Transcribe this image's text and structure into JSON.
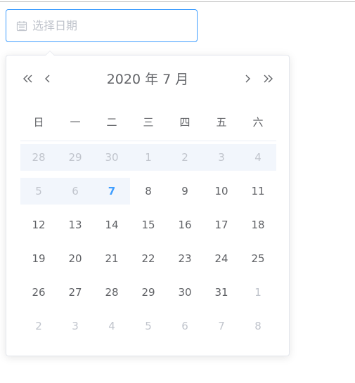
{
  "input": {
    "placeholder": "选择日期",
    "value": ""
  },
  "header": {
    "title": "2020 年  7 月"
  },
  "weekdays": [
    "日",
    "一",
    "二",
    "三",
    "四",
    "五",
    "六"
  ],
  "grid": [
    [
      {
        "d": "28",
        "o": true,
        "r": true
      },
      {
        "d": "29",
        "o": true,
        "r": true
      },
      {
        "d": "30",
        "o": true,
        "r": true
      },
      {
        "d": "1",
        "o": true,
        "r": true
      },
      {
        "d": "2",
        "o": true,
        "r": true
      },
      {
        "d": "3",
        "o": true,
        "r": true
      },
      {
        "d": "4",
        "o": true,
        "r": true
      }
    ],
    [
      {
        "d": "5",
        "o": true,
        "r": true
      },
      {
        "d": "6",
        "o": true,
        "r": true
      },
      {
        "d": "7",
        "today": true,
        "r": true
      },
      {
        "d": "8"
      },
      {
        "d": "9"
      },
      {
        "d": "10"
      },
      {
        "d": "11"
      }
    ],
    [
      {
        "d": "12"
      },
      {
        "d": "13"
      },
      {
        "d": "14"
      },
      {
        "d": "15"
      },
      {
        "d": "16"
      },
      {
        "d": "17"
      },
      {
        "d": "18"
      }
    ],
    [
      {
        "d": "19"
      },
      {
        "d": "20"
      },
      {
        "d": "21"
      },
      {
        "d": "22"
      },
      {
        "d": "23"
      },
      {
        "d": "24"
      },
      {
        "d": "25"
      }
    ],
    [
      {
        "d": "26"
      },
      {
        "d": "27"
      },
      {
        "d": "28"
      },
      {
        "d": "29"
      },
      {
        "d": "30"
      },
      {
        "d": "31"
      },
      {
        "d": "1",
        "o": true
      }
    ],
    [
      {
        "d": "2",
        "o": true
      },
      {
        "d": "3",
        "o": true
      },
      {
        "d": "4",
        "o": true
      },
      {
        "d": "5",
        "o": true
      },
      {
        "d": "6",
        "o": true
      },
      {
        "d": "7",
        "o": true
      },
      {
        "d": "8",
        "o": true
      }
    ]
  ],
  "colors": {
    "accent": "#409eff",
    "text": "#606266",
    "muted": "#c0c4cc",
    "range_bg": "#f2f6fc"
  },
  "icons": {
    "input": "calendar-icon",
    "prev_year": "double-chevron-left-icon",
    "prev_month": "chevron-left-icon",
    "next_month": "chevron-right-icon",
    "next_year": "double-chevron-right-icon"
  }
}
